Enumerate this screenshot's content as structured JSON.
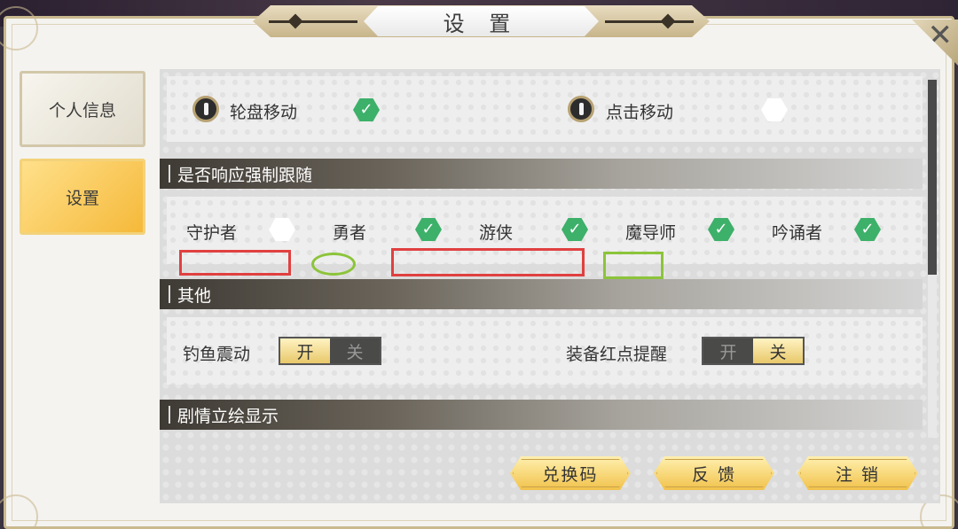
{
  "title": "设 置",
  "close_glyph": "✕",
  "tabs": [
    {
      "label": "个人信息",
      "selected": false
    },
    {
      "label": "设置",
      "selected": true
    }
  ],
  "movement": {
    "wheel": {
      "label": "轮盘移动",
      "checked": true
    },
    "click": {
      "label": "点击移动",
      "checked": false
    }
  },
  "follow_section": {
    "title": "是否响应强制跟随",
    "roles": [
      {
        "label": "守护者",
        "checked": false
      },
      {
        "label": "勇者",
        "checked": true
      },
      {
        "label": "游侠",
        "checked": true
      },
      {
        "label": "魔导师",
        "checked": true
      },
      {
        "label": "吟诵者",
        "checked": true
      }
    ]
  },
  "other_section": {
    "title": "其他",
    "fishing_vibration": {
      "label": "钓鱼震动",
      "on": "开",
      "off": "关",
      "state": "on"
    },
    "equip_reddot": {
      "label": "装备红点提醒",
      "on": "开",
      "off": "关",
      "state": "off"
    }
  },
  "story_section": {
    "title": "剧情立绘显示"
  },
  "actions": {
    "redeem": "兑换码",
    "feedback": "反 馈",
    "logout": "注 销"
  },
  "colors": {
    "check_green": "#3db06a",
    "accent_gold": "#f1c24a",
    "annotation_red": "#e04040",
    "annotation_green": "#8cc43a"
  }
}
